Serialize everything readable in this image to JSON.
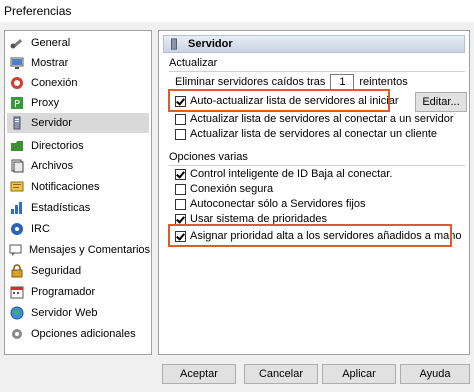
{
  "window": {
    "title": "Preferencias"
  },
  "sidebar": {
    "items": [
      {
        "label": "General",
        "icon": "wrench-icon"
      },
      {
        "label": "Mostrar",
        "icon": "monitor-icon"
      },
      {
        "label": "Conexión",
        "icon": "connection-icon"
      },
      {
        "label": "Proxy",
        "icon": "proxy-icon"
      },
      {
        "label": "Servidor",
        "icon": "server-icon",
        "selected": true
      },
      {
        "label": "Directorios",
        "icon": "folder-icon"
      },
      {
        "label": "Archivos",
        "icon": "files-icon"
      },
      {
        "label": "Notificaciones",
        "icon": "notification-icon"
      },
      {
        "label": "Estadísticas",
        "icon": "stats-icon"
      },
      {
        "label": "IRC",
        "icon": "irc-icon"
      },
      {
        "label": "Mensajes y Comentarios",
        "icon": "messages-icon"
      },
      {
        "label": "Seguridad",
        "icon": "lock-icon"
      },
      {
        "label": "Programador",
        "icon": "scheduler-icon"
      },
      {
        "label": "Servidor Web",
        "icon": "globe-icon"
      },
      {
        "label": "Opciones adicionales",
        "icon": "gear-icon"
      }
    ]
  },
  "panel": {
    "title": "Servidor",
    "group_actualizar": {
      "title": "Actualizar",
      "remove_prefix": "Eliminar servidores caídos tras",
      "remove_value": "1",
      "remove_suffix": "reintentos",
      "auto_update_start": "Auto-actualizar lista de servidores al iniciar",
      "update_on_connect_server": "Actualizar lista de servidores al conectar a un servidor",
      "update_on_connect_client": "Actualizar lista de servidores al conectar un cliente",
      "edit_button": "Editar..."
    },
    "group_opciones": {
      "title": "Opciones varias",
      "smart_lowid": "Control inteligente de ID Baja al conectar.",
      "secure_connection": "Conexión segura",
      "autoconnect_fixed": "Autoconectar sólo a Servidores fijos",
      "priority_system": "Usar sistema de prioridades",
      "high_priority_added": "Asignar prioridad alta a los servidores añadidos a mano"
    }
  },
  "buttons": {
    "accept": "Aceptar",
    "cancel": "Cancelar",
    "apply": "Aplicar",
    "help": "Ayuda"
  },
  "colors": {
    "highlight": "#e05a2a",
    "header_bg": "#c9d3e3",
    "selected_bg": "#d9d9d9"
  }
}
